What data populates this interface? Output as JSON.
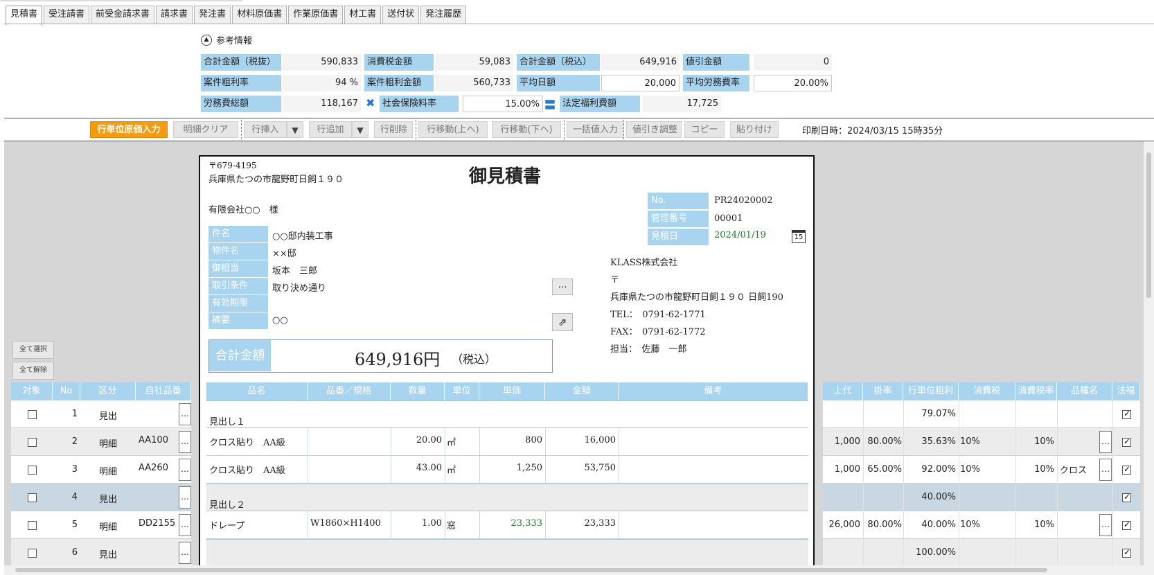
{
  "tabs": [
    "見積書",
    "受注請書",
    "前受金請求書",
    "請求書",
    "発注書",
    "材料原価書",
    "作業原価書",
    "材工書",
    "送付状",
    "発注履歴"
  ],
  "reference": {
    "title": "参考情報",
    "row1": [
      {
        "label": "合計金額（税抜）",
        "value": "590,833"
      },
      {
        "label": "消費税金額",
        "value": "59,083"
      },
      {
        "label": "合計金額（税込）",
        "value": "649,916"
      },
      {
        "label": "値引金額",
        "value": "0"
      }
    ],
    "row2": [
      {
        "label": "案件粗利率",
        "value": "94 %"
      },
      {
        "label": "案件粗利金額",
        "value": "560,733"
      },
      {
        "label": "平均日額",
        "value": "20,000"
      },
      {
        "label": "平均労務費率",
        "value": "20.00%"
      }
    ],
    "row3": [
      {
        "label": "労務費総額",
        "value": "118,167"
      },
      {
        "label": "社会保険料率",
        "value": "15.00%"
      },
      {
        "label": "法定福利費額",
        "value": "17,725"
      }
    ]
  },
  "toolbar": {
    "unit_cost": "行単位原価入力",
    "clear": "明細クリア",
    "insert": "行挿入",
    "add": "行追加",
    "delete": "行削除",
    "move_up": "行移動(上へ)",
    "move_down": "行移動(下へ)",
    "bulk": "一括値入力",
    "discount": "値引き調整",
    "copy": "コピー",
    "paste": "貼り付け",
    "print_date": "印刷日時：2024/03/15 15時35分"
  },
  "select_all": "全て選択",
  "deselect_all": "全て解除",
  "document": {
    "postal": "〒679-4195",
    "address": "兵庫県たつの市龍野町日飼１９０",
    "title": "御見積書",
    "customer": "有限会社○○　様",
    "meta": [
      {
        "label": "No.",
        "value": "PR24020002"
      },
      {
        "label": "管理番号",
        "value": "00001"
      },
      {
        "label": "見積日",
        "value": "2024/01/19"
      }
    ],
    "calendar_day": "15",
    "fields": [
      {
        "label": "件名",
        "value": "○○邸内装工事"
      },
      {
        "label": "物件名",
        "value": "××邸"
      },
      {
        "label": "御担当",
        "value": "坂本　三郎"
      },
      {
        "label": "取引条件",
        "value": "取り決め通り"
      },
      {
        "label": "有効期限",
        "value": ""
      },
      {
        "label": "摘要",
        "value": "○○"
      }
    ],
    "company": {
      "name": "KLASS株式会社",
      "postal": "〒",
      "address": "兵庫県たつの市龍野町日飼１９０ 日飼190",
      "tel": "TEL：　0791-62-1771",
      "fax": "FAX：　0791-62-1772",
      "person": "担当：　佐藤　一郎"
    },
    "total_label": "合計金額",
    "total_value": "649,916円",
    "total_note": "（税込）"
  },
  "left_headers": [
    "対象",
    "No",
    "区分",
    "自社品番"
  ],
  "doc_headers": [
    "品名",
    "品番／規格",
    "数量",
    "単位",
    "単価",
    "金額",
    "備考"
  ],
  "right_headers": [
    "上代",
    "掛率",
    "行単位粗利",
    "消費税",
    "消費税率",
    "品種名",
    "法福"
  ],
  "rows": [
    {
      "no": "1",
      "kubun": "見出",
      "code": "",
      "name": "見出し１",
      "spec": "",
      "qty": "",
      "unit": "",
      "price": "",
      "amount": "",
      "jodai": "",
      "rate": "",
      "profit": "79.07%",
      "tax": "",
      "taxrate": "",
      "kind": "",
      "fuku": true,
      "heading": true
    },
    {
      "no": "2",
      "kubun": "明細",
      "code": "AA100",
      "name": "クロス貼り　AA級",
      "spec": "",
      "qty": "20.00",
      "unit": "㎡",
      "price": "800",
      "amount": "16,000",
      "jodai": "1,000",
      "rate": "80.00%",
      "profit": "35.63%",
      "tax": "10%",
      "taxrate": "10%",
      "kind": "",
      "fuku": true,
      "heading": false
    },
    {
      "no": "3",
      "kubun": "明細",
      "code": "AA260",
      "name": "クロス貼り　AA級",
      "spec": "",
      "qty": "43.00",
      "unit": "㎡",
      "price": "1,250",
      "amount": "53,750",
      "jodai": "1,000",
      "rate": "65.00%",
      "profit": "92.00%",
      "tax": "10%",
      "taxrate": "10%",
      "kind": "クロス",
      "fuku": true,
      "heading": false
    },
    {
      "no": "4",
      "kubun": "見出",
      "code": "",
      "name": "見出し２",
      "spec": "",
      "qty": "",
      "unit": "",
      "price": "",
      "amount": "",
      "jodai": "",
      "rate": "",
      "profit": "40.00%",
      "tax": "",
      "taxrate": "",
      "kind": "",
      "fuku": true,
      "heading": true
    },
    {
      "no": "5",
      "kubun": "明細",
      "code": "DD2155",
      "name": "ドレープ",
      "spec": "W1860×H1400",
      "qty": "1.00",
      "unit": "窓",
      "price": "23,333",
      "amount": "23,333",
      "jodai": "26,000",
      "rate": "80.00%",
      "profit": "40.00%",
      "tax": "10%",
      "taxrate": "10%",
      "kind": "",
      "fuku": true,
      "heading": false
    },
    {
      "no": "6",
      "kubun": "見出",
      "code": "",
      "name": "",
      "spec": "",
      "qty": "",
      "unit": "",
      "price": "",
      "amount": "",
      "jodai": "",
      "rate": "",
      "profit": "100.00%",
      "tax": "",
      "taxrate": "",
      "kind": "",
      "fuku": true,
      "heading": true
    }
  ],
  "colors": {
    "header_blue": "#a8d4f0",
    "accent_orange": "#f39c12",
    "selected_row": "#c9d7e3"
  }
}
